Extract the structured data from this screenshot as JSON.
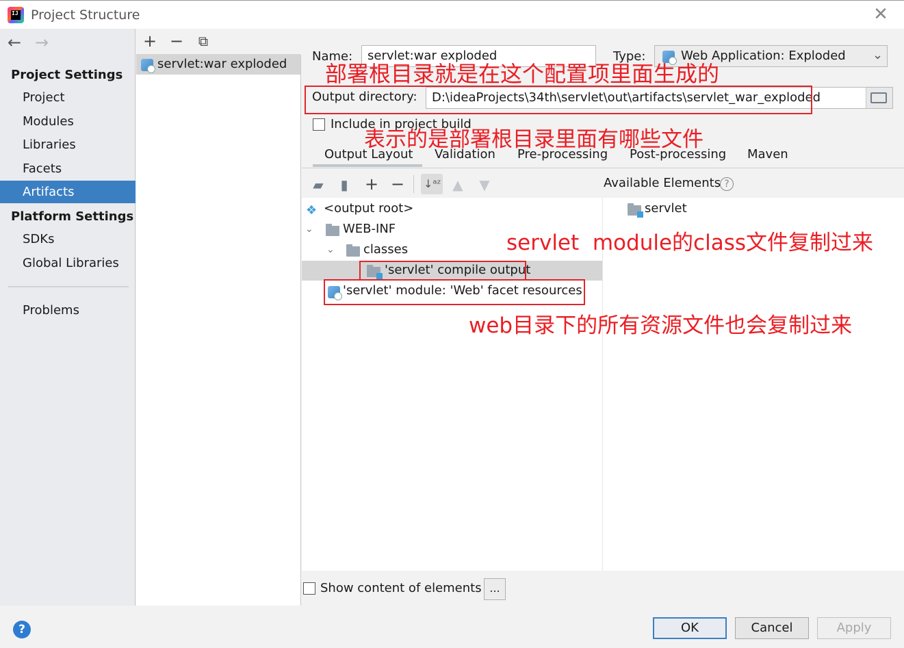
{
  "window": {
    "title": "Project Structure"
  },
  "sidebar": {
    "project_settings_heading": "Project Settings",
    "project_items": [
      "Project",
      "Modules",
      "Libraries",
      "Facets",
      "Artifacts"
    ],
    "selected": "Artifacts",
    "platform_settings_heading": "Platform Settings",
    "platform_items": [
      "SDKs",
      "Global Libraries"
    ],
    "problems": "Problems"
  },
  "artifacts_list": {
    "items": [
      "servlet:war exploded"
    ]
  },
  "artifact": {
    "name_label": "Name:",
    "name_value": "servlet:war exploded",
    "type_label": "Type:",
    "type_value": "Web Application: Exploded",
    "output_dir_label": "Output directory:",
    "output_dir_value": "D:\\ideaProjects\\34th\\servlet\\out\\artifacts\\servlet_war_exploded",
    "include_label": "Include in project build",
    "tabs": [
      "Output Layout",
      "Validation",
      "Pre-processing",
      "Post-processing",
      "Maven"
    ],
    "active_tab": "Output Layout"
  },
  "layout_tree": {
    "root": "<output root>",
    "web_inf": "WEB-INF",
    "classes": "classes",
    "compile_output": "'servlet' compile output",
    "facet_resources": "'servlet' module: 'Web' facet resources"
  },
  "available": {
    "heading": "Available Elements",
    "items": [
      "servlet"
    ]
  },
  "show_content": {
    "label": "Show content of elements",
    "button": "..."
  },
  "annotations": {
    "root_dir": "部署根目录就是在这个配置项里面生成的",
    "contents": "表示的是部署根目录里面有哪些文件",
    "class_copy": "servlet  module的class文件复制过来",
    "web_copy": "web目录下的所有资源文件也会复制过来"
  },
  "footer": {
    "ok": "OK",
    "cancel": "Cancel",
    "apply": "Apply"
  },
  "colors": {
    "selection": "#3b7fc3",
    "annotation": "#ea1e24"
  }
}
